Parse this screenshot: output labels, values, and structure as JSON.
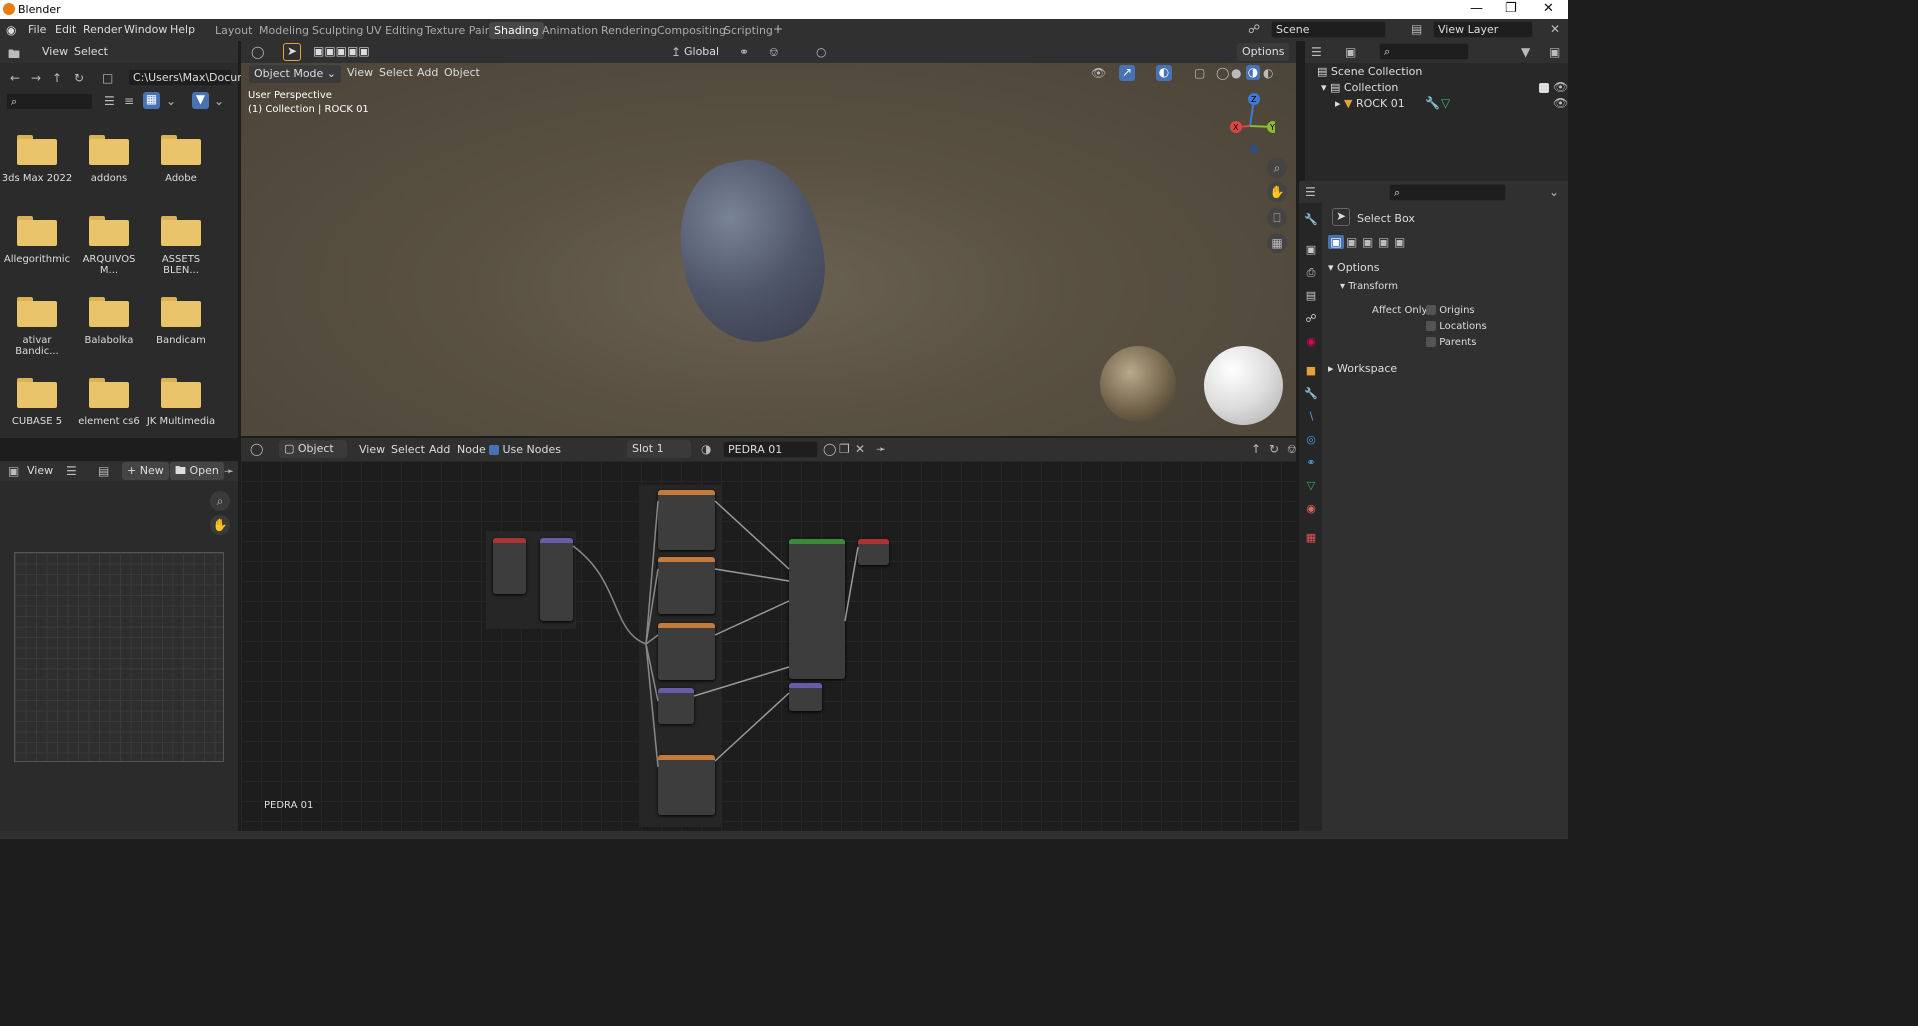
{
  "window": {
    "title": "Blender"
  },
  "menu": [
    "File",
    "Edit",
    "Render",
    "Window",
    "Help"
  ],
  "workspaces": [
    "Layout",
    "Modeling",
    "Sculpting",
    "UV Editing",
    "Texture Paint",
    "Shading",
    "Animation",
    "Rendering",
    "Compositing",
    "Scripting"
  ],
  "active_workspace": "Shading",
  "scene": {
    "name": "Scene",
    "view_layer": "View Layer"
  },
  "file_browser": {
    "menu": [
      "View",
      "Select"
    ],
    "path": "C:\\Users\\Max\\Docume...",
    "folders": [
      "3ds Max 2022",
      "addons",
      "Adobe",
      "Allegorithmic",
      "ARQUIVOS M...",
      "ASSETS BLEN...",
      "ativar Bandic...",
      "Balabolka",
      "Bandicam",
      "CUBASE 5",
      "element cs6",
      "JK Multimedia"
    ]
  },
  "viewport": {
    "transform": "Global",
    "options": "Options",
    "mode": "Object Mode",
    "menu": [
      "View",
      "Select",
      "Add",
      "Object"
    ],
    "info_line1": "User Perspective",
    "info_line2": "(1) Collection | ROCK 01",
    "gizmo": {
      "x": "X",
      "y": "Y",
      "z": "Z"
    }
  },
  "node_editor": {
    "type": "Object",
    "menu": [
      "View",
      "Select",
      "Add",
      "Node"
    ],
    "use_nodes": "Use Nodes",
    "slot": "Slot 1",
    "material": "PEDRA 01",
    "footer_label": "PEDRA 01"
  },
  "image_editor": {
    "view": "View",
    "new": "New",
    "open": "Open"
  },
  "outliner": {
    "root": "Scene Collection",
    "collection": "Collection",
    "object": "ROCK 01"
  },
  "properties": {
    "tool": "Select Box",
    "options": "Options",
    "transform": "Transform",
    "affect_only": "Affect Only",
    "checks": [
      "Origins",
      "Locations",
      "Parents"
    ],
    "workspace": "Workspace"
  }
}
